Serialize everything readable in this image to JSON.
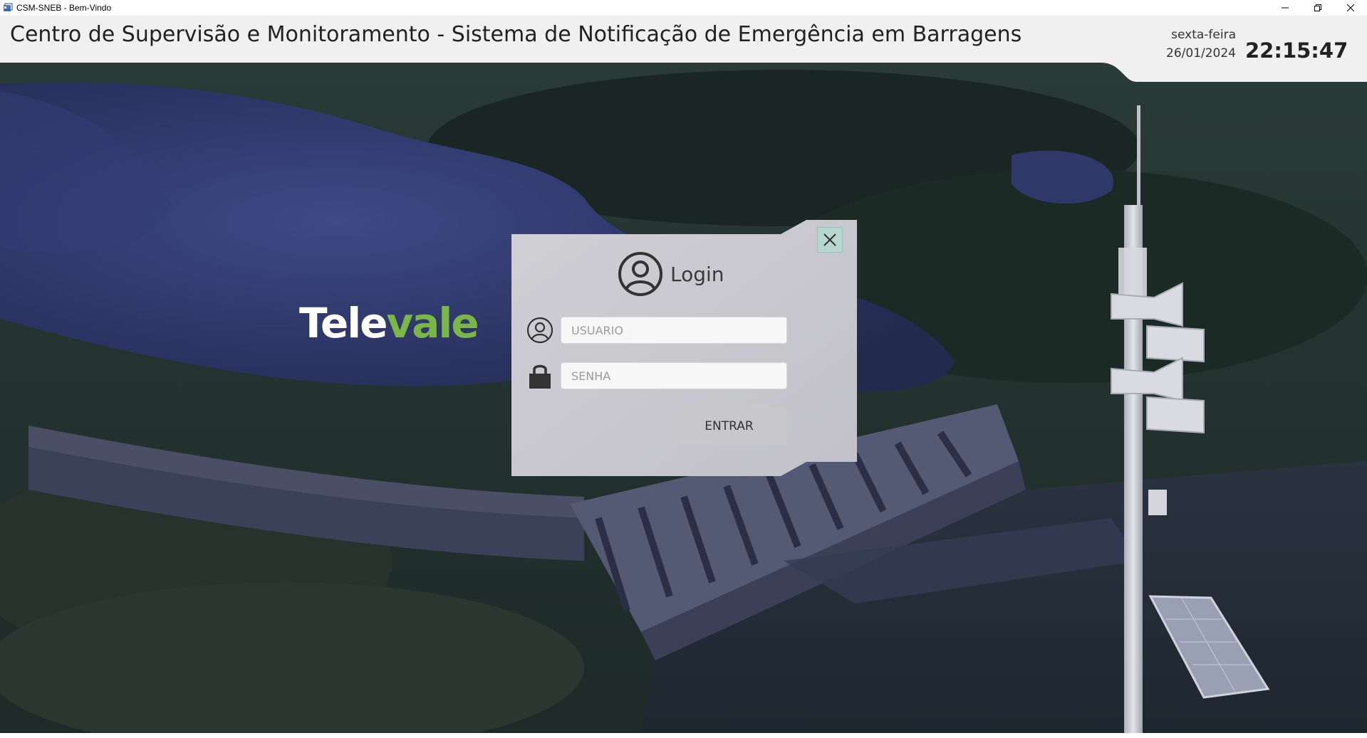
{
  "window": {
    "title": "CSM-SNEB - Bem-Vindo",
    "controls": [
      "minimize-icon",
      "restore-icon",
      "close-icon"
    ]
  },
  "header": {
    "title": "Centro de Supervisão e Monitoramento - Sistema de Notificação de Emergência em Barragens",
    "weekday": "sexta-feira",
    "date": "26/01/2024",
    "time": "22:15:47"
  },
  "logo": {
    "part1": "Tele",
    "part2": "vale"
  },
  "login": {
    "title": "Login",
    "username_placeholder": "USUARIO",
    "username_value": "",
    "password_placeholder": "SENHA",
    "password_value": "",
    "submit_label": "ENTRAR",
    "icons": [
      "user-circle-icon",
      "user-icon",
      "lock-icon",
      "close-icon"
    ]
  },
  "colors": {
    "header_bg": "#f0f0f0",
    "dialog_bg": "#c9c8cf",
    "close_button_bg": "#b7d6cd",
    "logo_green": "#7ab648",
    "scene_water": "#2d3566"
  }
}
